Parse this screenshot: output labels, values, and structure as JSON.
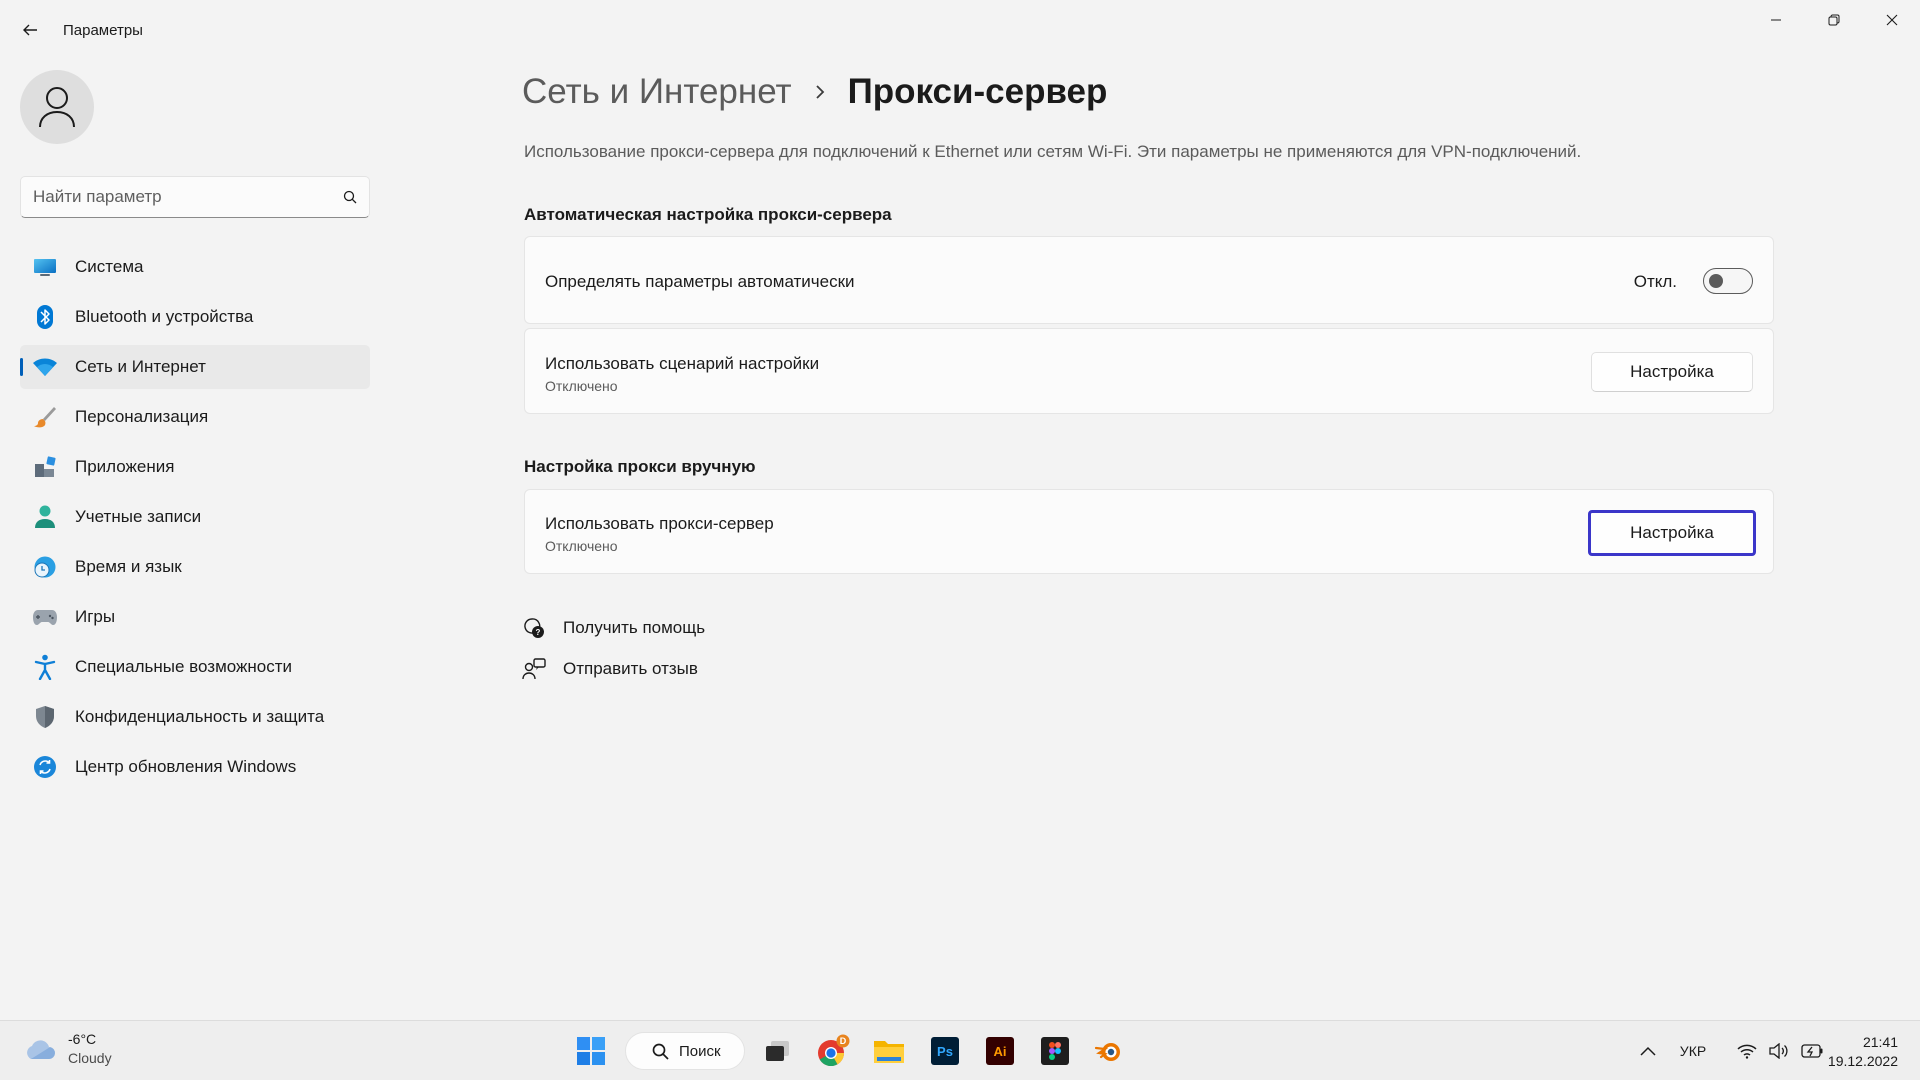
{
  "app": {
    "title": "Параметры"
  },
  "search": {
    "placeholder": "Найти параметр"
  },
  "sidebar": {
    "items": [
      {
        "label": "Система",
        "icon": "display-icon"
      },
      {
        "label": "Bluetooth и устройства",
        "icon": "bluetooth-icon"
      },
      {
        "label": "Сеть и Интернет",
        "icon": "wifi-icon",
        "active": true
      },
      {
        "label": "Персонализация",
        "icon": "brush-icon"
      },
      {
        "label": "Приложения",
        "icon": "apps-icon"
      },
      {
        "label": "Учетные записи",
        "icon": "person-icon"
      },
      {
        "label": "Время и язык",
        "icon": "globe-clock-icon"
      },
      {
        "label": "Игры",
        "icon": "gamepad-icon"
      },
      {
        "label": "Специальные возможности",
        "icon": "accessibility-icon"
      },
      {
        "label": "Конфиденциальность и защита",
        "icon": "shield-icon"
      },
      {
        "label": "Центр обновления Windows",
        "icon": "update-icon"
      }
    ]
  },
  "breadcrumb": {
    "parent": "Сеть и Интернет",
    "current": "Прокси-сервер"
  },
  "page": {
    "description": "Использование прокси-сервера для подключений к Ethernet или сетям Wi-Fi. Эти параметры не применяются для VPN-подключений."
  },
  "auto_section": {
    "title": "Автоматическая настройка прокси-сервера",
    "detect": {
      "title": "Определять параметры автоматически",
      "state_label": "Откл.",
      "enabled": false
    },
    "script": {
      "title": "Использовать сценарий настройки",
      "status": "Отключено",
      "button": "Настройка"
    }
  },
  "manual_section": {
    "title": "Настройка прокси вручную",
    "proxy": {
      "title": "Использовать прокси-сервер",
      "status": "Отключено",
      "button": "Настройка"
    }
  },
  "links": {
    "help": "Получить помощь",
    "feedback": "Отправить отзыв"
  },
  "taskbar": {
    "weather": {
      "temp": "-6°C",
      "condition": "Cloudy"
    },
    "search_label": "Поиск",
    "apps": [
      "windows-start-icon",
      "task-view-icon",
      "chrome-icon",
      "file-explorer-icon",
      "photoshop-icon",
      "illustrator-icon",
      "figma-icon",
      "blender-icon"
    ],
    "chrome_badge": "D",
    "ps_label": "Ps",
    "ai_label": "Ai",
    "language": "УКР",
    "time": "21:41",
    "date": "19.12.2022"
  },
  "colors": {
    "accent": "#005fb8",
    "focus_ring": "#3b36c9",
    "background": "#f3f3f3",
    "card": "#fbfbfb"
  }
}
